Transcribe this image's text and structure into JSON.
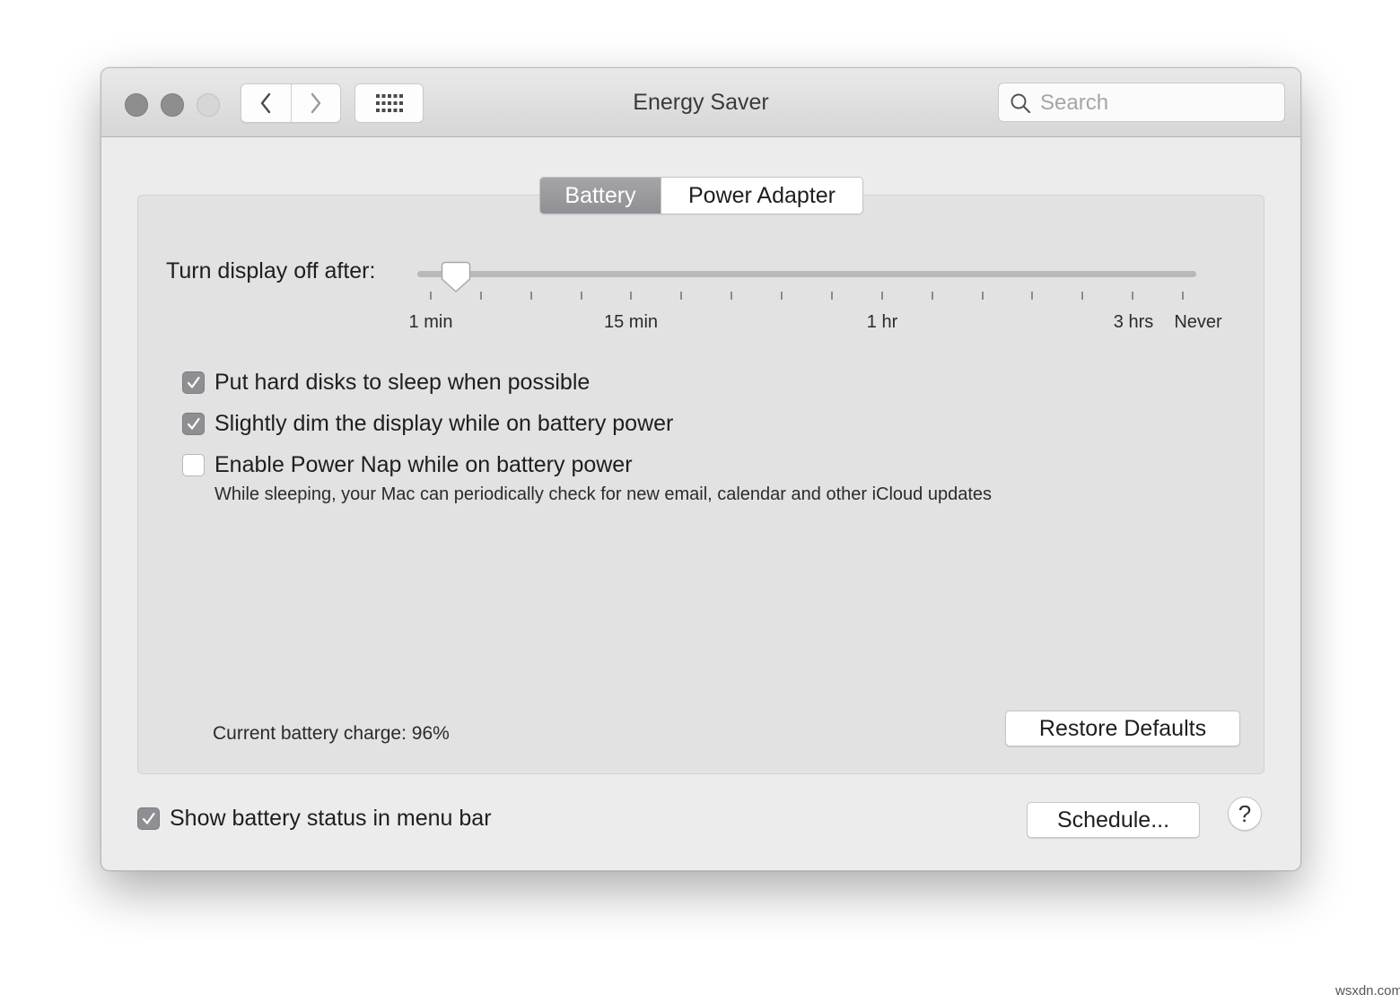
{
  "window": {
    "title": "Energy Saver",
    "traffic_lights": [
      "close",
      "minimize",
      "zoom"
    ]
  },
  "toolbar": {
    "back_icon": "chevron-left-icon",
    "forward_icon": "chevron-right-icon",
    "show_all_icon": "grid-icon",
    "search_placeholder": "Search"
  },
  "tabs": [
    {
      "label": "Battery",
      "selected": true
    },
    {
      "label": "Power Adapter",
      "selected": false
    }
  ],
  "display_sleep": {
    "label": "Turn display off after:",
    "tick_labels": {
      "min1": "1 min",
      "min15": "15 min",
      "hr1": "1 hr",
      "hrs3": "3 hrs",
      "never": "Never"
    },
    "tick_count": 16,
    "selected_value": "2 min"
  },
  "options": [
    {
      "label": "Put hard disks to sleep when possible",
      "checked": true
    },
    {
      "label": "Slightly dim the display while on battery power",
      "checked": true
    },
    {
      "label": "Enable Power Nap while on battery power",
      "checked": false
    }
  ],
  "power_nap_note": "While sleeping, your Mac can periodically check for new email, calendar and other iCloud updates",
  "battery_charge": "Current battery charge: 96%",
  "restore_defaults": "Restore Defaults",
  "show_status": {
    "label": "Show battery status in menu bar",
    "checked": true
  },
  "schedule_button": "Schedule...",
  "help_button": "?",
  "watermark": "wsxdn.com",
  "colors": {
    "window_bg": "#ececec",
    "panel_bg": "#e2e2e2",
    "selected_tab": "#9a9a9e",
    "checkbox_checked": "#8e8e93"
  }
}
